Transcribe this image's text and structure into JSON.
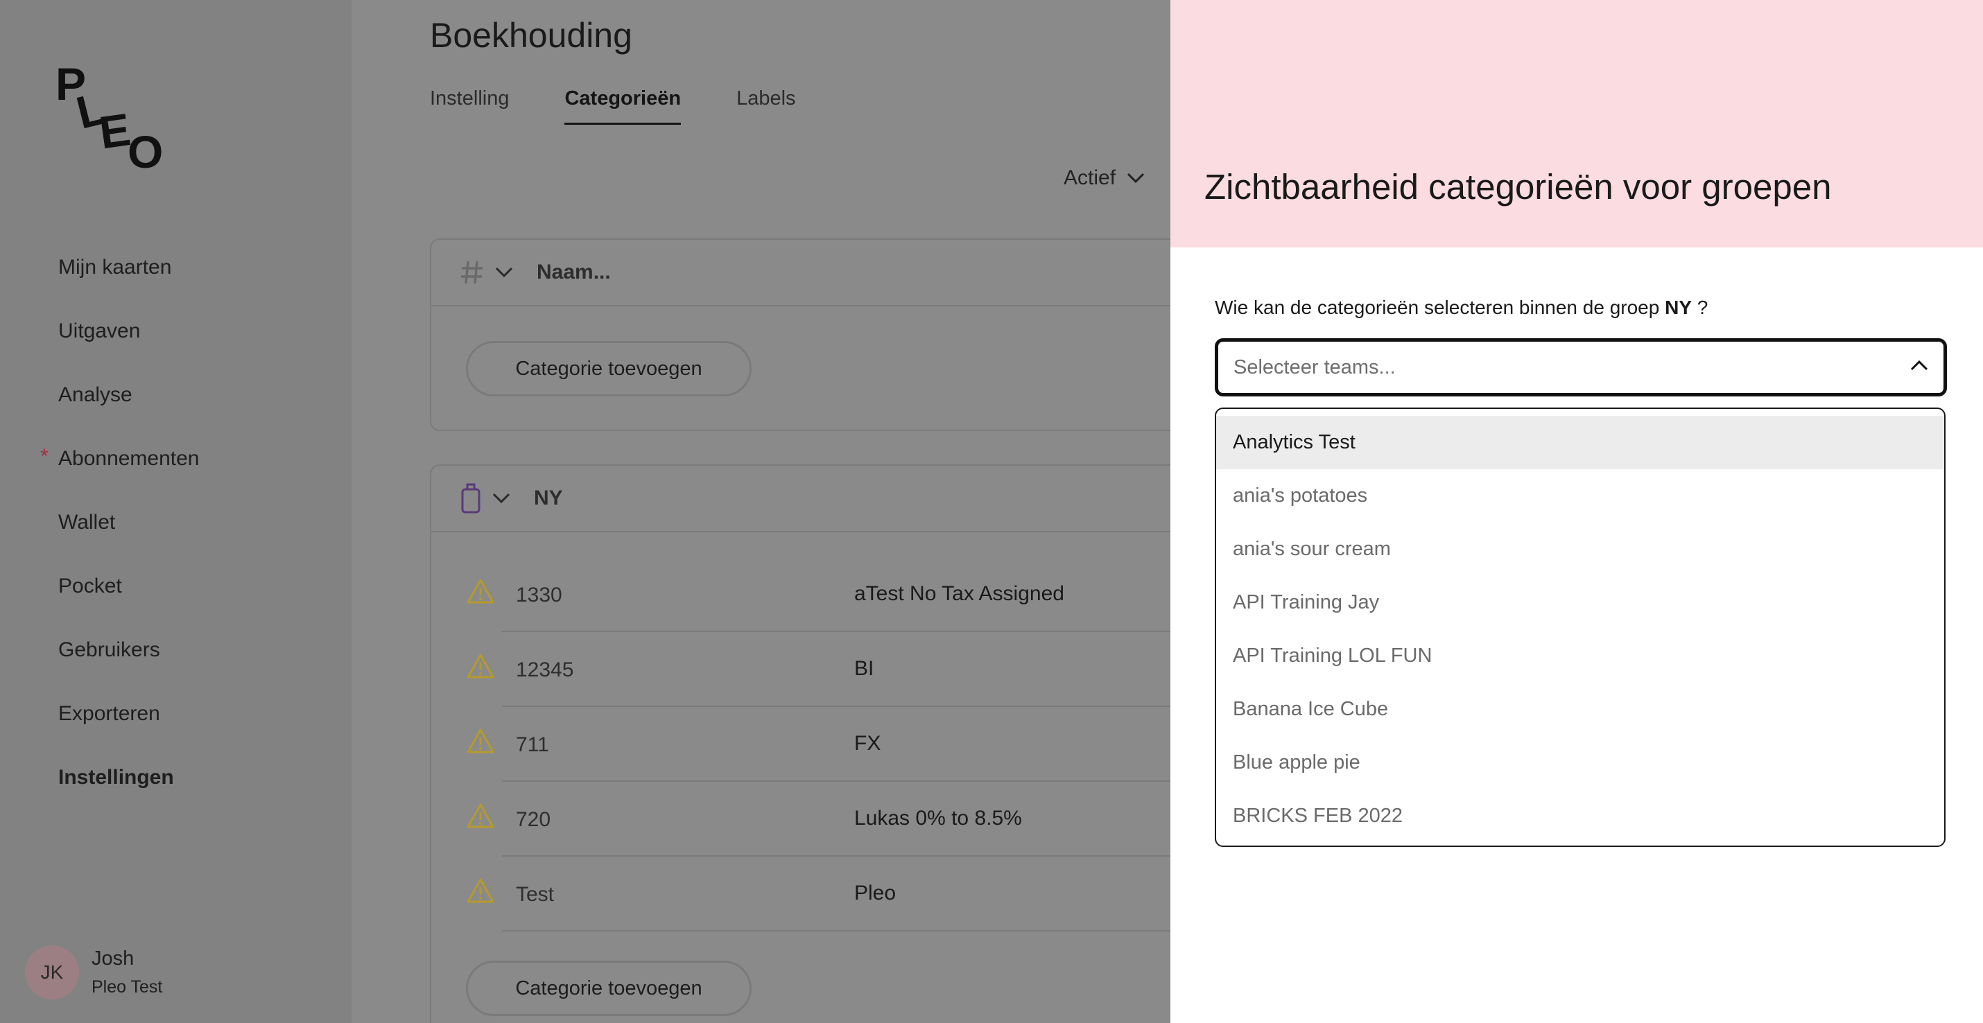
{
  "sidebar": {
    "logo_text": "PLEO",
    "items": [
      {
        "label": "Mijn kaarten",
        "dot": false,
        "active": false
      },
      {
        "label": "Uitgaven",
        "dot": false,
        "active": false
      },
      {
        "label": "Analyse",
        "dot": false,
        "active": false
      },
      {
        "label": "Abonnementen",
        "dot": true,
        "active": false
      },
      {
        "label": "Wallet",
        "dot": false,
        "active": false
      },
      {
        "label": "Pocket",
        "dot": false,
        "active": false
      },
      {
        "label": "Gebruikers",
        "dot": false,
        "active": false
      },
      {
        "label": "Exporteren",
        "dot": false,
        "active": false
      },
      {
        "label": "Instellingen",
        "dot": false,
        "active": true
      }
    ],
    "dot_glyph": "*",
    "user": {
      "initials": "JK",
      "name": "Josh",
      "org": "Pleo Test"
    }
  },
  "main": {
    "title": "Boekhouding",
    "tabs": [
      {
        "label": "Instelling",
        "active": false
      },
      {
        "label": "Categorieën",
        "active": true
      },
      {
        "label": "Labels",
        "active": false
      }
    ],
    "filter_label": "Actief",
    "group1": {
      "name": "Naam...",
      "add_label": "Categorie toevoegen"
    },
    "group2": {
      "name": "NY",
      "add_label": "Categorie toevoegen",
      "rows": [
        {
          "code": "1330",
          "label": "aTest No Tax Assigned"
        },
        {
          "code": "12345",
          "label": "BI"
        },
        {
          "code": "711",
          "label": "FX"
        },
        {
          "code": "720",
          "label": "Lukas 0% to 8.5%"
        },
        {
          "code": "Test",
          "label": "Pleo"
        }
      ]
    }
  },
  "drawer": {
    "title": "Zichtbaarheid categorieën voor groepen",
    "question_prefix": "Wie kan de categorieën selecteren binnen de groep",
    "question_group": "NY",
    "question_suffix": "?",
    "select_placeholder": "Selecteer teams...",
    "options": [
      "Analytics Test",
      "ania's potatoes",
      "ania's sour cream",
      "API Training Jay",
      "API Training LOL FUN",
      "Banana Ice Cube",
      "Blue apple pie",
      "BRICKS FEB 2022"
    ]
  },
  "colors": {
    "drawer_header": "#fadce1",
    "overlay": "#8a8a8a",
    "warning": "#b59a2c",
    "category_icon": "#5b3a78"
  }
}
